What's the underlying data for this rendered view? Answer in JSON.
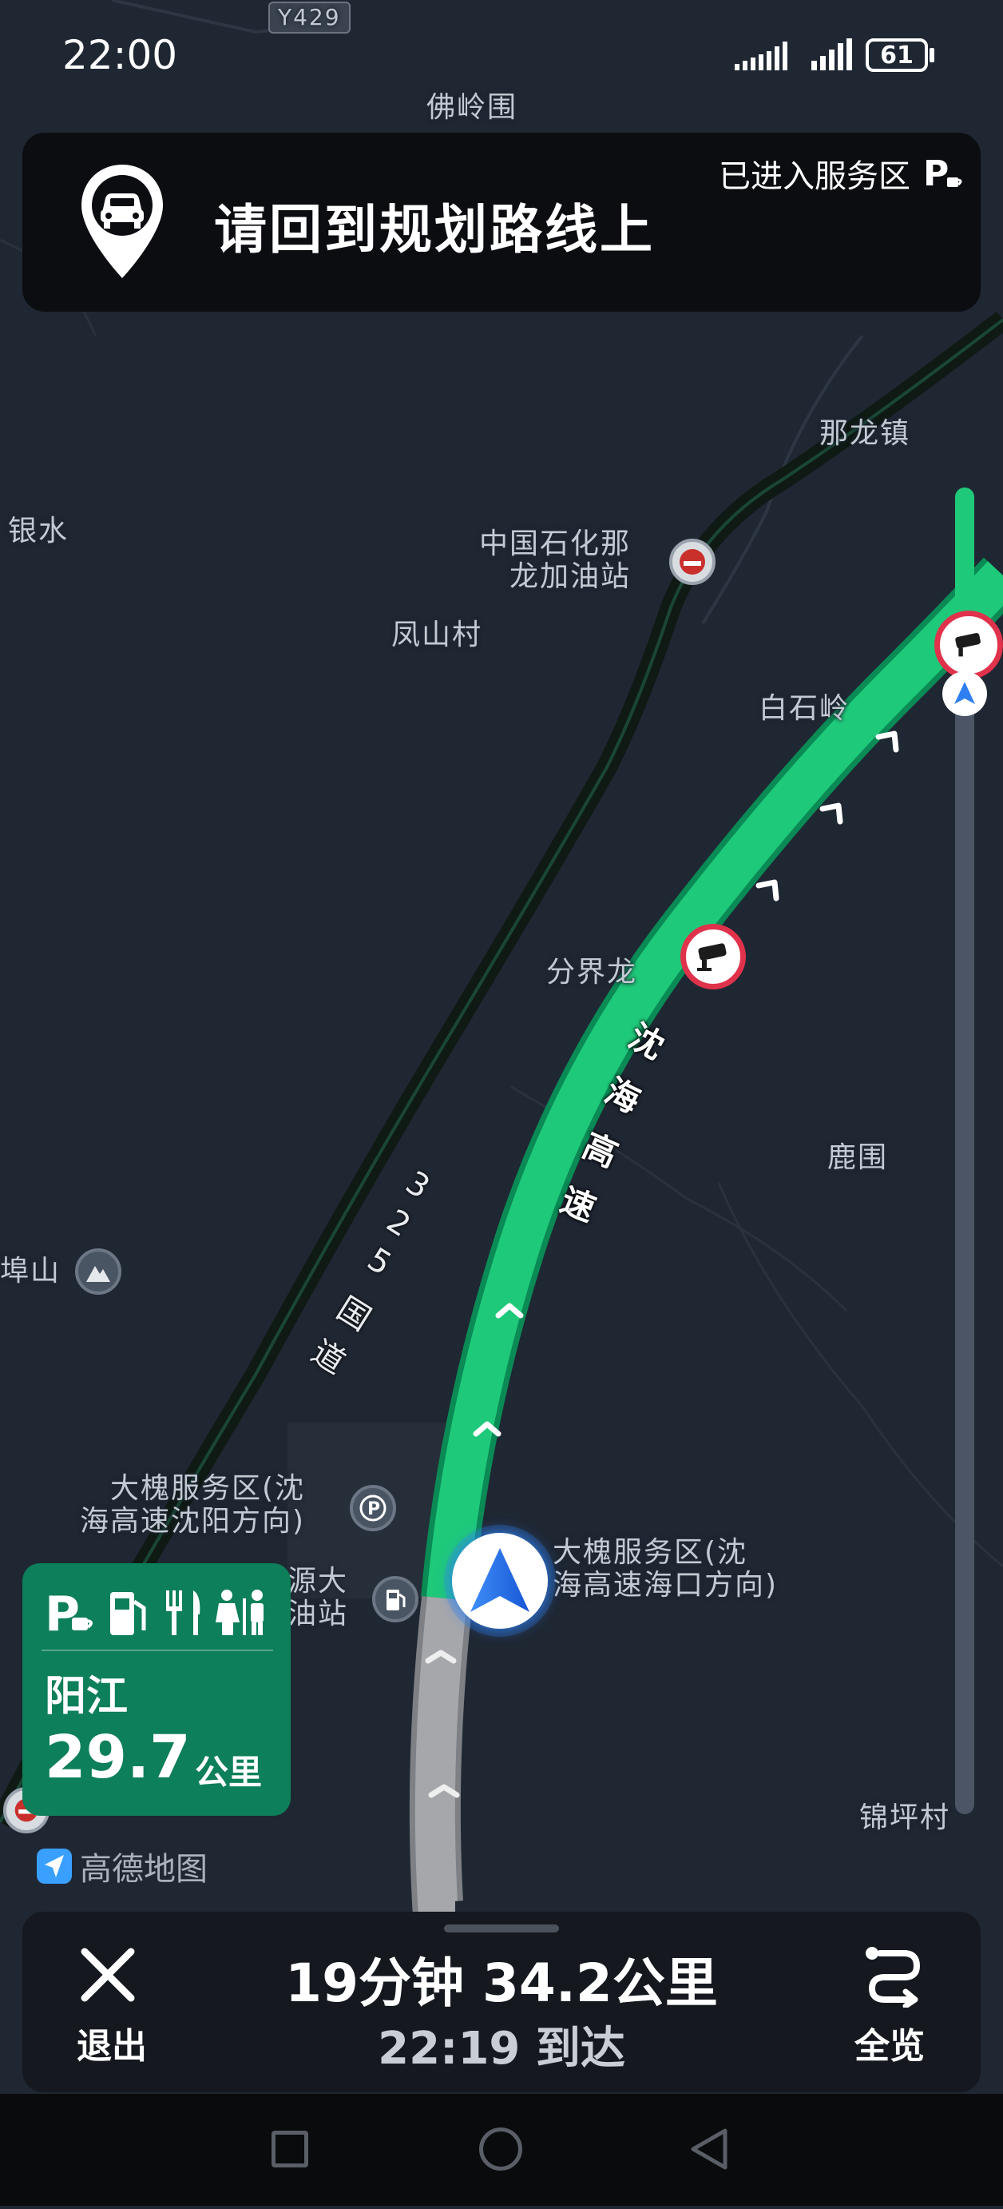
{
  "status_bar": {
    "time": "22:00",
    "battery": "61"
  },
  "banner": {
    "instruction": "请回到规划路线上",
    "status_text": "已进入服务区",
    "status_icon": "parking-cafe-icon"
  },
  "map": {
    "labels": {
      "road_y429": "Y429",
      "foling": "佛岭围",
      "nalong": "那龙镇",
      "yinshui": "银水",
      "sinopec_l1": "中国石化那",
      "sinopec_l2": "龙加油站",
      "fengshan": "凤山村",
      "baishiling": "白石岭",
      "fenjielong": "分界龙",
      "luwei": "鹿围",
      "fushan": "埠山",
      "sa_sy_l1": "大槐服务区(沈",
      "sa_sy_l2": "海高速沈阳方向)",
      "gas_l1": "源大",
      "gas_l2": "油站",
      "sa_hk_l1": "大槐服务区(沈",
      "sa_hk_l2": "海高速海口方向)",
      "jinping": "锦坪村"
    },
    "highway_name": [
      "沈",
      "海",
      "高",
      "速"
    ],
    "national_road_name": [
      "3",
      "2",
      "5",
      "国",
      "道"
    ],
    "route_color": "#1fc97a",
    "traveled_color": "#9a9a9a",
    "camera_icon": "speed-camera-icon"
  },
  "service_area_card": {
    "facilities": [
      "parking-cafe-icon",
      "fuel-icon",
      "restaurant-icon",
      "toilet-icon"
    ],
    "name": "阳江",
    "distance": "29.7",
    "unit": "公里"
  },
  "brand": "高德地图",
  "bottom": {
    "exit_label": "退出",
    "summary": "19分钟  34.2公里",
    "eta": "22:19 到达",
    "overview_label": "全览"
  }
}
